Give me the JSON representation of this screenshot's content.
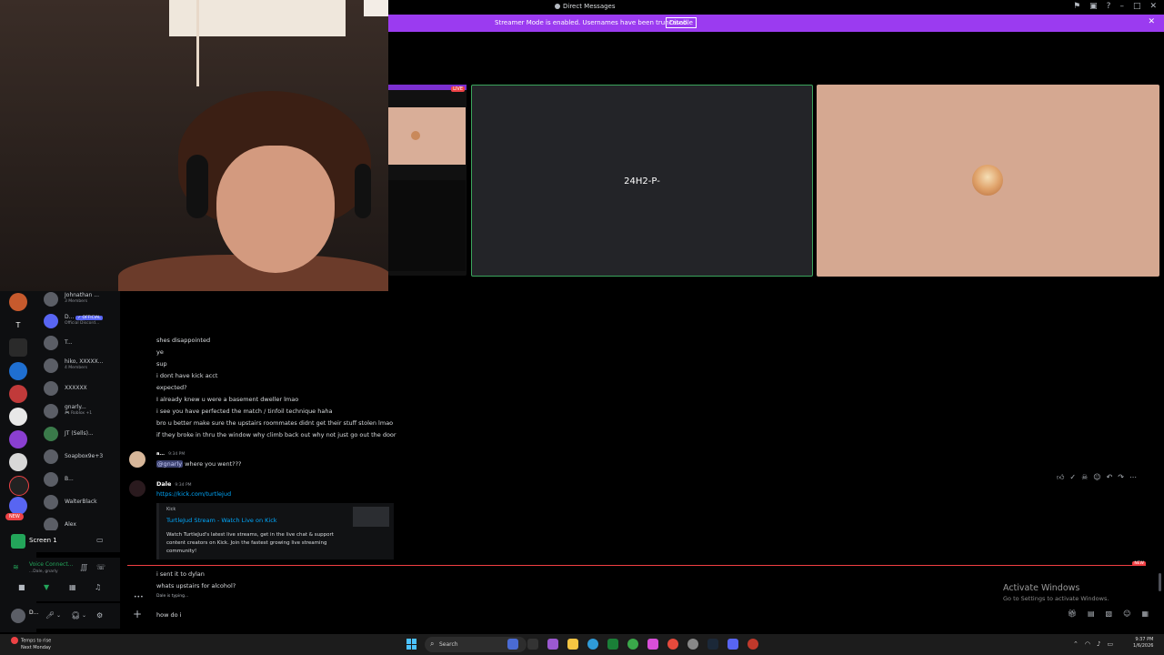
{
  "window": {
    "title": "Direct Messages"
  },
  "banner": {
    "text": "Streamer Mode is enabled. Usernames have been truncated.",
    "disable_label": "Disable",
    "close": "✕",
    "color": "#9b3bf0"
  },
  "call": {
    "stream_live_label": "LIVE",
    "user1_name": "24H2-P-",
    "speaking_color": "#3ba55d"
  },
  "servers": {
    "new_label": "NEW",
    "letter_server": "T"
  },
  "dm_list": [
    {
      "name": "Johnathan ...",
      "sub": "3 Members"
    },
    {
      "name": "D...",
      "badge": "✓ OFFICIAL",
      "sub": "Official Discord..."
    },
    {
      "name": "T...",
      "sub": ""
    },
    {
      "name": "hiko, XXXXX...",
      "sub": "4 Members"
    },
    {
      "name": "XXXXXX",
      "sub": ""
    },
    {
      "name": "gnarly...",
      "sub": "🎮 Roblox +1"
    },
    {
      "name": "JT (Sells)...",
      "sub": ""
    },
    {
      "name": "Soapbox9e+3",
      "sub": ""
    },
    {
      "name": "B...",
      "sub": ""
    },
    {
      "name": "WalterBlack",
      "sub": ""
    },
    {
      "name": "Alex",
      "sub": ""
    }
  ],
  "screen_share": {
    "label": "Screen 1"
  },
  "voice": {
    "status": "Voice Connect...",
    "sub": "...Dale, gnarly"
  },
  "user_panel": {
    "name": "D..."
  },
  "chat": {
    "lines_top": [
      "shes disappointed",
      "ye",
      "sup",
      "i dont have kick acct",
      "expected?",
      "I already knew u were a basement dweller lmao",
      "i see you have perfected the match / tinfoil technique haha",
      "bro u better make sure the upstairs roommates didnt get their stuff stolen lmao",
      "if they broke in thru the window why climb back out why not just go out the door"
    ],
    "msg1": {
      "author": "a...",
      "time": "9:34 PM",
      "mention": "@gnarly",
      "text": " where you went???"
    },
    "msg2": {
      "author": "Dale",
      "time": "9:34 PM",
      "link": "https://kick.com/turtlejud",
      "embed": {
        "provider": "Kick",
        "title": "TurtleJud Stream - Watch Live on Kick",
        "description": "Watch TurtleJud's latest live streams, get in the live chat & support content creators on Kick. Join the fastest growing live streaming community!"
      }
    },
    "new_label": "NEW",
    "lines_after": [
      "i sent it to dylan",
      "whats upstairs for alcohol?"
    ],
    "typing": "Dale is typing...",
    "composer_value": "how do i",
    "activate_title": "Activate Windows",
    "activate_sub": "Go to Settings to activate Windows."
  },
  "taskbar": {
    "weather_line1": "Temps to rise",
    "weather_line2": "Next Monday",
    "search_label": "Search",
    "time": "9:37 PM",
    "date": "1/6/2026"
  }
}
